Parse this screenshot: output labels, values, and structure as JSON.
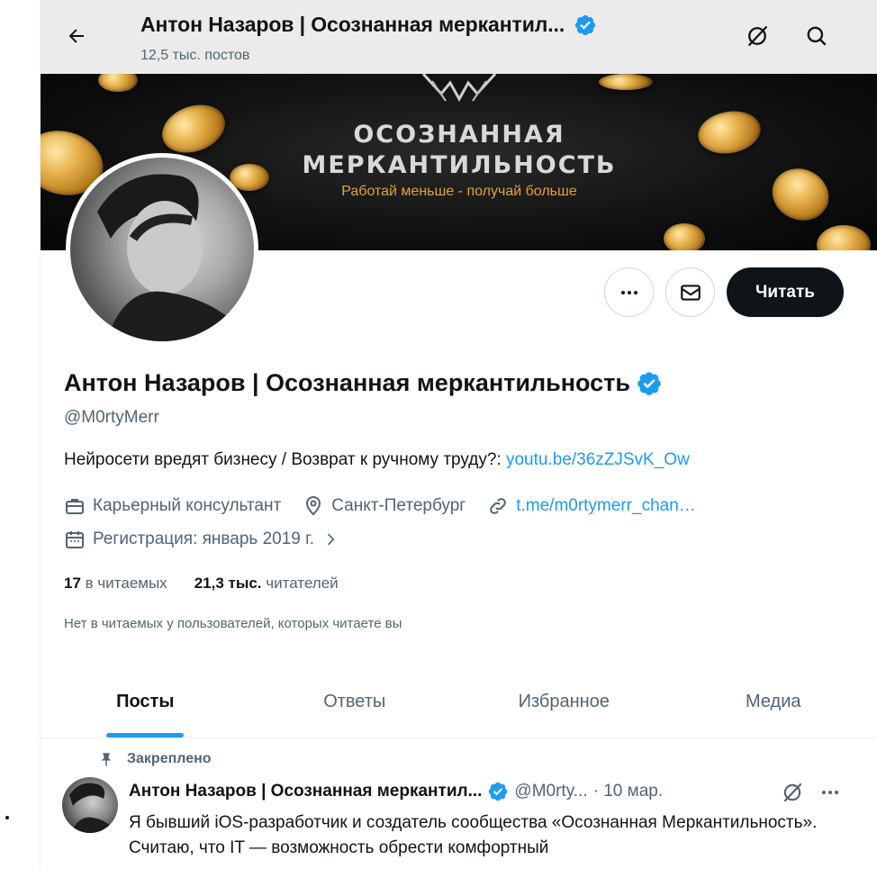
{
  "header": {
    "title": "Антон Назаров | Осознанная меркантил...",
    "subtitle": "12,5 тыс. постов"
  },
  "banner": {
    "line1": "ОСОЗНАННАЯ",
    "line2": "МЕРКАНТИЛЬНОСТЬ",
    "tagline": "Работай меньше - получай больше"
  },
  "actions": {
    "follow_label": "Читать"
  },
  "profile": {
    "name": "Антон Назаров | Осознанная меркантильность",
    "handle": "@M0rtyMerr",
    "bio_text": "Нейросети вредят бизнесу / Возврат к ручному труду?: ",
    "bio_link": "youtu.be/36zZJSvK_Ow",
    "job": "Карьерный консультант",
    "location": "Санкт-Петербург",
    "website": "t.me/m0rtymerr_chan…",
    "joined": "Регистрация: январь 2019 г."
  },
  "stats": {
    "following_count": "17",
    "following_label": "в читаемых",
    "followers_count": "21,3 тыс.",
    "followers_label": "читателей"
  },
  "followed_by_note": "Нет в читаемых у пользователей, которых читаете вы",
  "tabs": [
    {
      "label": "Посты",
      "active": true
    },
    {
      "label": "Ответы",
      "active": false
    },
    {
      "label": "Избранное",
      "active": false
    },
    {
      "label": "Медиа",
      "active": false
    }
  ],
  "pinned_tweet": {
    "pinned_label": "Закреплено",
    "author": "Антон Назаров | Осознанная меркантил...",
    "handle": "@M0rty...",
    "date": "· 10 мар.",
    "text": "Я бывший iOS-разработчик и создатель сообщества «Осознанная Меркантильность». Считаю, что IT — возможность обрести комфортный"
  },
  "colors": {
    "accent": "#1d9bf0",
    "text": "#0f1419",
    "muted": "#536471",
    "header_bg": "#ebebeb"
  }
}
